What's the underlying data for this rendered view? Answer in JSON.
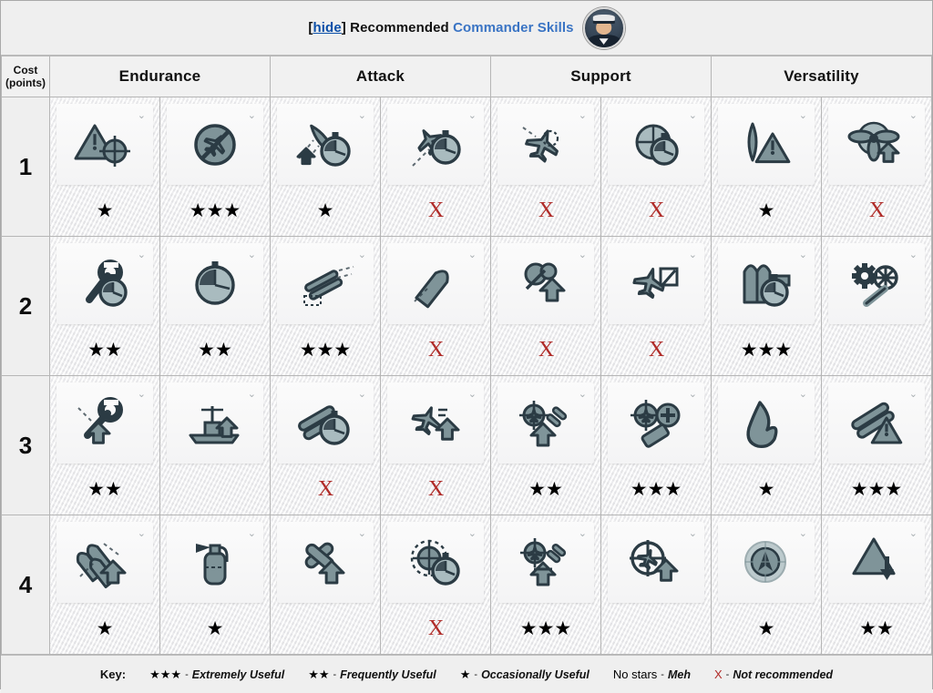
{
  "header": {
    "hide_label": "hide",
    "bracket_open": "[",
    "bracket_close": "]",
    "title_prefix": "Recommended",
    "title_link": "Commander Skills",
    "avatar_name": "commander-portrait",
    "link_color": "#0b4fa8",
    "title_color": "#3a74c4"
  },
  "table": {
    "cost_header_line1": "Cost",
    "cost_header_line2": "(points)",
    "categories": [
      "Endurance",
      "Attack",
      "Support",
      "Versatility"
    ],
    "rows": [
      {
        "cost": "1",
        "cells": [
          {
            "icon": "priority-target-icon",
            "rating": "1",
            "rating_text": "★"
          },
          {
            "icon": "no-aircraft-spotting-icon",
            "rating": "3",
            "rating_text": "★★★"
          },
          {
            "icon": "ship-speed-timer-icon",
            "rating": "1",
            "rating_text": "★"
          },
          {
            "icon": "aircraft-timer-icon",
            "rating": "x",
            "rating_text": "X"
          },
          {
            "icon": "bomber-squadron-icon",
            "rating": "x",
            "rating_text": "X"
          },
          {
            "icon": "aa-gun-timer-icon",
            "rating": "x",
            "rating_text": "X"
          },
          {
            "icon": "torpedo-warning-icon",
            "rating": "1",
            "rating_text": "★"
          },
          {
            "icon": "propeller-boost-icon",
            "rating": "x",
            "rating_text": "X"
          }
        ]
      },
      {
        "cost": "2",
        "cells": [
          {
            "icon": "wrench-timer-icon",
            "rating": "2",
            "rating_text": "★★"
          },
          {
            "icon": "stopwatch-icon",
            "rating": "2",
            "rating_text": "★★"
          },
          {
            "icon": "torpedo-launcher-icon",
            "rating": "3",
            "rating_text": "★★★"
          },
          {
            "icon": "torpedo-range-up-icon",
            "rating": "x",
            "rating_text": "X"
          },
          {
            "icon": "smoke-boost-icon",
            "rating": "x",
            "rating_text": "X"
          },
          {
            "icon": "aircraft-carrier-icon",
            "rating": "x",
            "rating_text": "X"
          },
          {
            "icon": "shell-timer-icon",
            "rating": "3",
            "rating_text": "★★★"
          },
          {
            "icon": "gear-wrench-icon",
            "rating": "0",
            "rating_text": ""
          }
        ]
      },
      {
        "cost": "3",
        "cells": [
          {
            "icon": "wrench-boost-icon",
            "rating": "2",
            "rating_text": "★★"
          },
          {
            "icon": "battleship-boost-icon",
            "rating": "0",
            "rating_text": ""
          },
          {
            "icon": "artillery-timer-icon",
            "rating": "x",
            "rating_text": "X"
          },
          {
            "icon": "aircraft-boost-icon",
            "rating": "x",
            "rating_text": "X"
          },
          {
            "icon": "aa-guns-boost-icon",
            "rating": "2",
            "rating_text": "★★"
          },
          {
            "icon": "aa-plus-icon",
            "rating": "3",
            "rating_text": "★★★"
          },
          {
            "icon": "fire-torpedo-icon",
            "rating": "1",
            "rating_text": "★"
          },
          {
            "icon": "torpedo-warning-alert-icon",
            "rating": "3",
            "rating_text": "★★★"
          }
        ]
      },
      {
        "cost": "4",
        "cells": [
          {
            "icon": "shells-boost-icon",
            "rating": "1",
            "rating_text": "★"
          },
          {
            "icon": "fire-extinguisher-icon",
            "rating": "1",
            "rating_text": "★"
          },
          {
            "icon": "torpedo-cross-boost-icon",
            "rating": "0",
            "rating_text": ""
          },
          {
            "icon": "radar-timer-icon",
            "rating": "x",
            "rating_text": "X"
          },
          {
            "icon": "aa-squadron-boost-icon",
            "rating": "3",
            "rating_text": "★★★"
          },
          {
            "icon": "aircraft-target-boost-icon",
            "rating": "0",
            "rating_text": ""
          },
          {
            "icon": "compass-radar-icon",
            "rating": "1",
            "rating_text": "★"
          },
          {
            "icon": "warning-down-icon",
            "rating": "2",
            "rating_text": "★★"
          }
        ]
      }
    ]
  },
  "key": {
    "lead": "Key:",
    "items": [
      {
        "symbol": "★★★",
        "dash": "-",
        "text": "Extremely Useful",
        "is_x": false
      },
      {
        "symbol": "★★",
        "dash": "-",
        "text": "Frequently Useful",
        "is_x": false
      },
      {
        "symbol": "★",
        "dash": "-",
        "text": "Occasionally Useful",
        "is_x": false
      },
      {
        "symbol": "No stars",
        "dash": "-",
        "text": "Meh",
        "is_x": false
      },
      {
        "symbol": "X",
        "dash": "-",
        "text": "Not recommended",
        "is_x": true
      }
    ]
  }
}
